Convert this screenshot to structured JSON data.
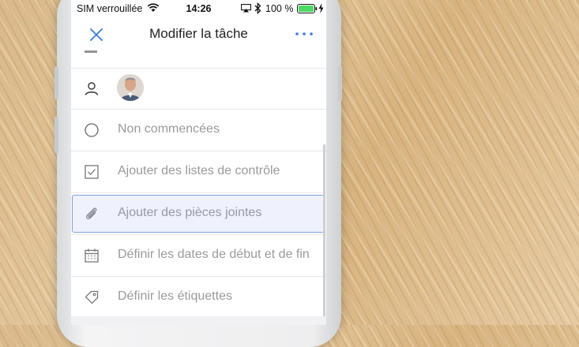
{
  "status_bar": {
    "carrier": "SIM verrouillée",
    "time": "14:26",
    "battery": "100 %"
  },
  "nav": {
    "title": "Modifier la tâche",
    "close_icon": "close-icon",
    "more_icon": "more-icon"
  },
  "rows": [
    {
      "icon": "person-icon",
      "label": ""
    },
    {
      "icon": "circle-icon",
      "label": "Non commencées"
    },
    {
      "icon": "checklist-icon",
      "label": "Ajouter des listes de contrôle"
    },
    {
      "icon": "paperclip-icon",
      "label": "Ajouter des pièces jointes"
    },
    {
      "icon": "calendar-icon",
      "label": "Définir les dates de début et de fin"
    },
    {
      "icon": "tag-icon",
      "label": "Définir les étiquettes"
    }
  ],
  "colors": {
    "accent": "#3a7bd5",
    "highlight_border": "#7f9fe0",
    "battery": "#4cd964"
  }
}
